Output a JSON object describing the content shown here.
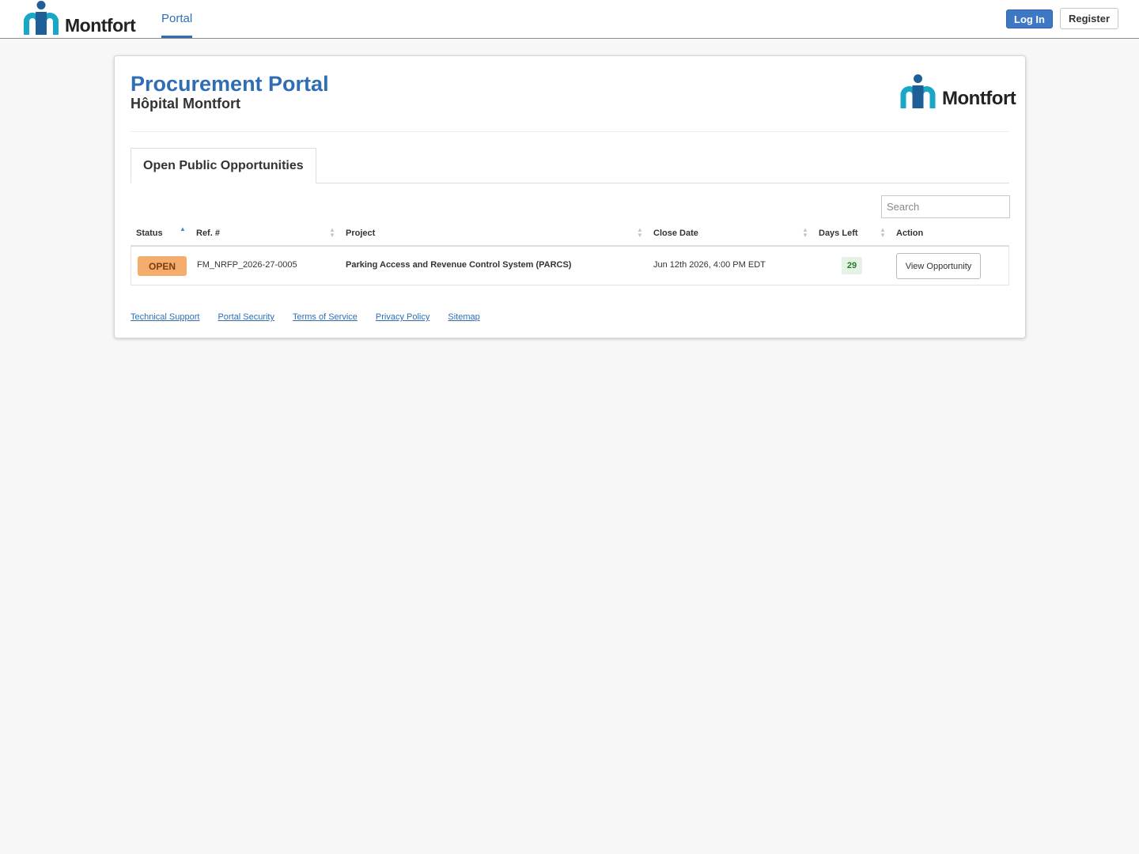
{
  "nav": {
    "logo_text": "Montfort",
    "portal_tab": "Portal",
    "login_label": "Log In",
    "register_label": "Register"
  },
  "header": {
    "title": "Procurement Portal",
    "subtitle": "Hôpital Montfort",
    "logo_text": "Montfort"
  },
  "tabs": {
    "active": "Open Public Opportunities"
  },
  "search": {
    "placeholder": "Search",
    "value": ""
  },
  "table": {
    "columns": [
      "Status",
      "Ref. #",
      "Project",
      "Close Date",
      "Days Left",
      "Action"
    ],
    "sorted_column": "Status",
    "rows": [
      {
        "status": "OPEN",
        "ref": "FM_NRFP_2026-27-0005",
        "project": "Parking Access and Revenue Control System (PARCS)",
        "close_date": "Jun 12th 2026, 4:00 PM EDT",
        "days_left": "29",
        "action": "View Opportunity"
      }
    ]
  },
  "footer": {
    "links": [
      "Technical Support",
      "Portal Security",
      "Terms of Service",
      "Privacy Policy",
      "Sitemap"
    ]
  },
  "colors": {
    "brand_blue": "#2f6eb5",
    "logo_teal": "#1aa6c6",
    "logo_navy": "#1f5f98",
    "status_open": "#f4ad6c",
    "days_left_bg": "#e5f3e5"
  }
}
